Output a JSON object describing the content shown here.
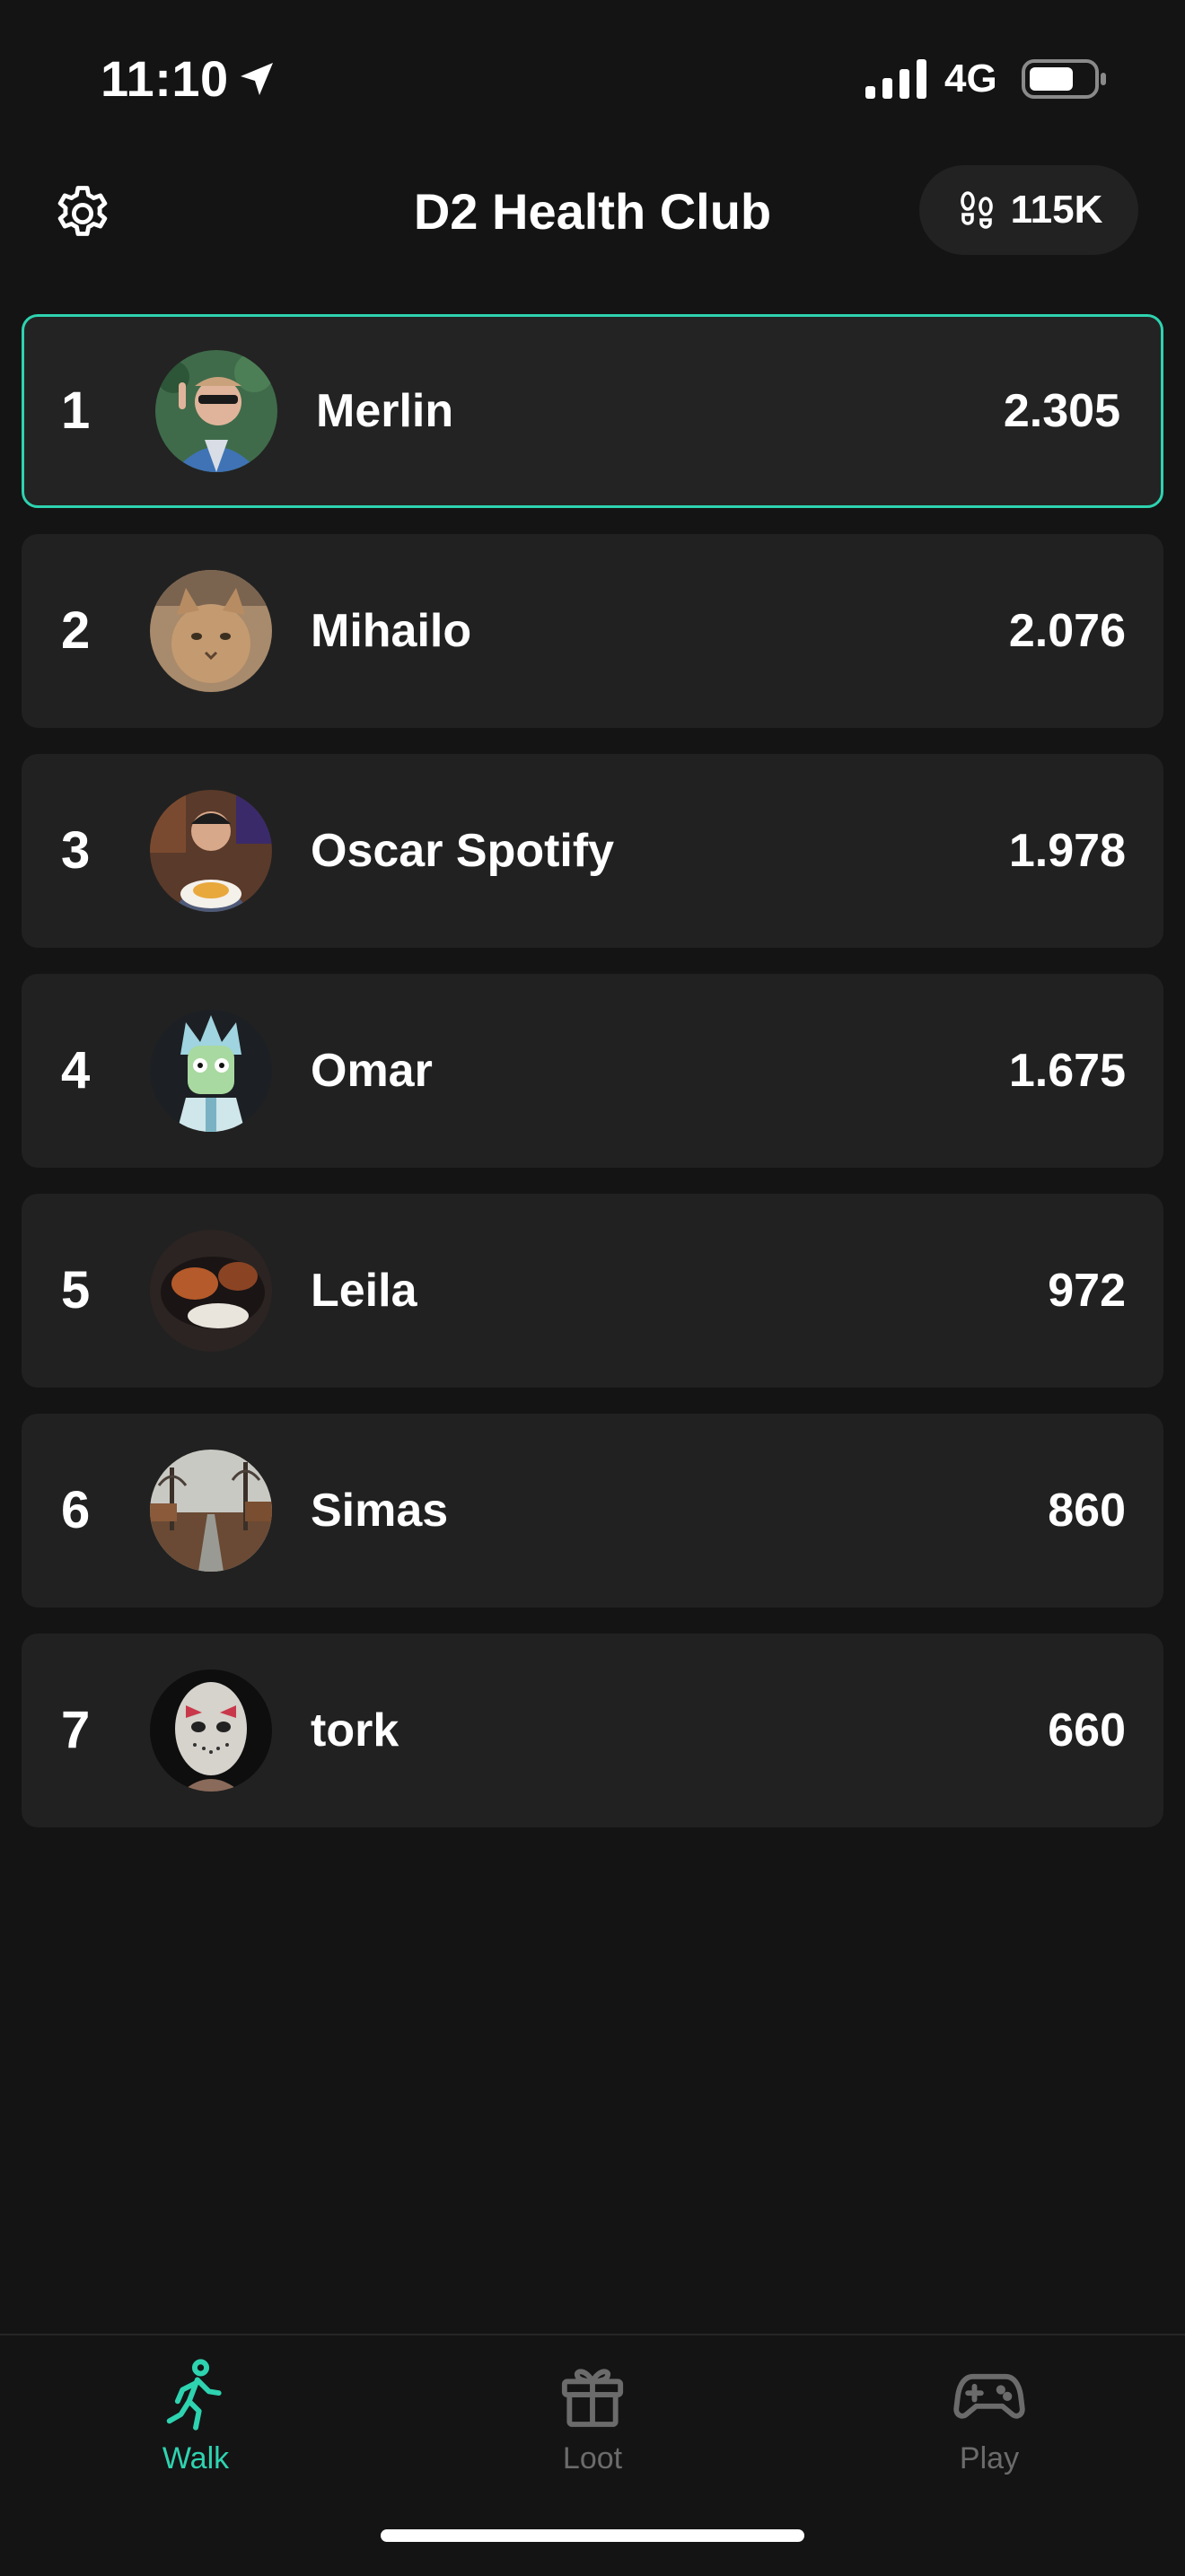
{
  "status_bar": {
    "time": "11:10",
    "network": "4G"
  },
  "header": {
    "title": "D2 Health Club",
    "steps_total": "115K"
  },
  "leaderboard": [
    {
      "rank": "1",
      "name": "Merlin",
      "score": "2.305",
      "avatar": "avatar-merlin"
    },
    {
      "rank": "2",
      "name": "Mihailo",
      "score": "2.076",
      "avatar": "avatar-mihailo"
    },
    {
      "rank": "3",
      "name": "Oscar Spotify",
      "score": "1.978",
      "avatar": "avatar-oscar"
    },
    {
      "rank": "4",
      "name": "Omar",
      "score": "1.675",
      "avatar": "avatar-omar"
    },
    {
      "rank": "5",
      "name": "Leila",
      "score": "972",
      "avatar": "avatar-leila"
    },
    {
      "rank": "6",
      "name": "Simas",
      "score": "860",
      "avatar": "avatar-simas"
    },
    {
      "rank": "7",
      "name": "tork",
      "score": "660",
      "avatar": "avatar-tork"
    }
  ],
  "tabs": [
    {
      "label": "Walk",
      "icon": "walk-icon",
      "active": true
    },
    {
      "label": "Loot",
      "icon": "gift-icon",
      "active": false
    },
    {
      "label": "Play",
      "icon": "gamepad-icon",
      "active": false
    }
  ],
  "colors": {
    "background": "#141414",
    "card": "#212121",
    "accent": "#2ed3b0",
    "inactive": "#6b6b6b",
    "text": "#ffffff"
  }
}
